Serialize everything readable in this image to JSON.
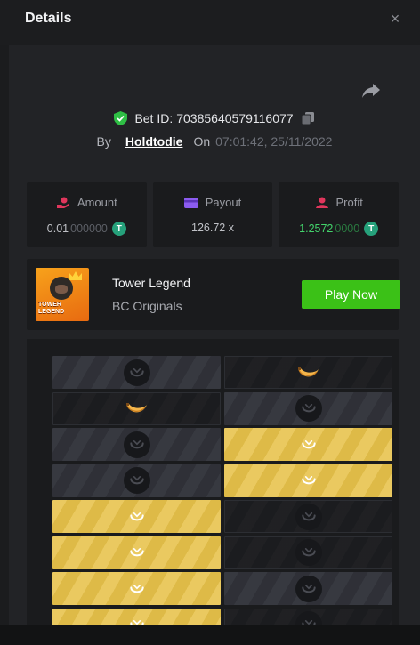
{
  "header": {
    "title": "Details",
    "close_label": "×"
  },
  "bet": {
    "id_label": "Bet ID:",
    "id_value": "70385640579116077",
    "by_label": "By",
    "username": "Holdtodie",
    "on_label": "On",
    "timestamp": "07:01:42, 25/11/2022"
  },
  "stats": {
    "amount": {
      "label": "Amount",
      "value_main": "0.01",
      "value_dim": "000000",
      "coin": "T"
    },
    "payout": {
      "label": "Payout",
      "value": "126.72 x"
    },
    "profit": {
      "label": "Profit",
      "value_main": "1.2572",
      "value_dim": "0000",
      "coin": "T"
    }
  },
  "game": {
    "thumb_text": "TOWER LEGEND",
    "title": "Tower Legend",
    "provider": "BC Originals",
    "play_label": "Play Now"
  },
  "board": {
    "rows": [
      [
        "dim-logo",
        "dark-banana"
      ],
      [
        "dark-banana",
        "dim-logo"
      ],
      [
        "dim-logo",
        "gold-logo"
      ],
      [
        "dim-logo",
        "gold-logo"
      ],
      [
        "gold-logo",
        "dark-logo"
      ],
      [
        "gold-logo",
        "dark-logo"
      ],
      [
        "gold-logo",
        "dim-logo"
      ],
      [
        "gold-logo",
        "dark-logo"
      ]
    ]
  },
  "colors": {
    "accent_green": "#3bc117",
    "gold": "#e7c24a",
    "profit_green": "#43d36b"
  },
  "icons": {
    "close": "close-icon",
    "share": "share-icon",
    "verified": "shield-check-icon",
    "copy": "copy-icon",
    "amount": "hand-coin-icon",
    "payout": "wallet-icon",
    "profit": "user-coin-icon",
    "coin": "tether-icon"
  }
}
